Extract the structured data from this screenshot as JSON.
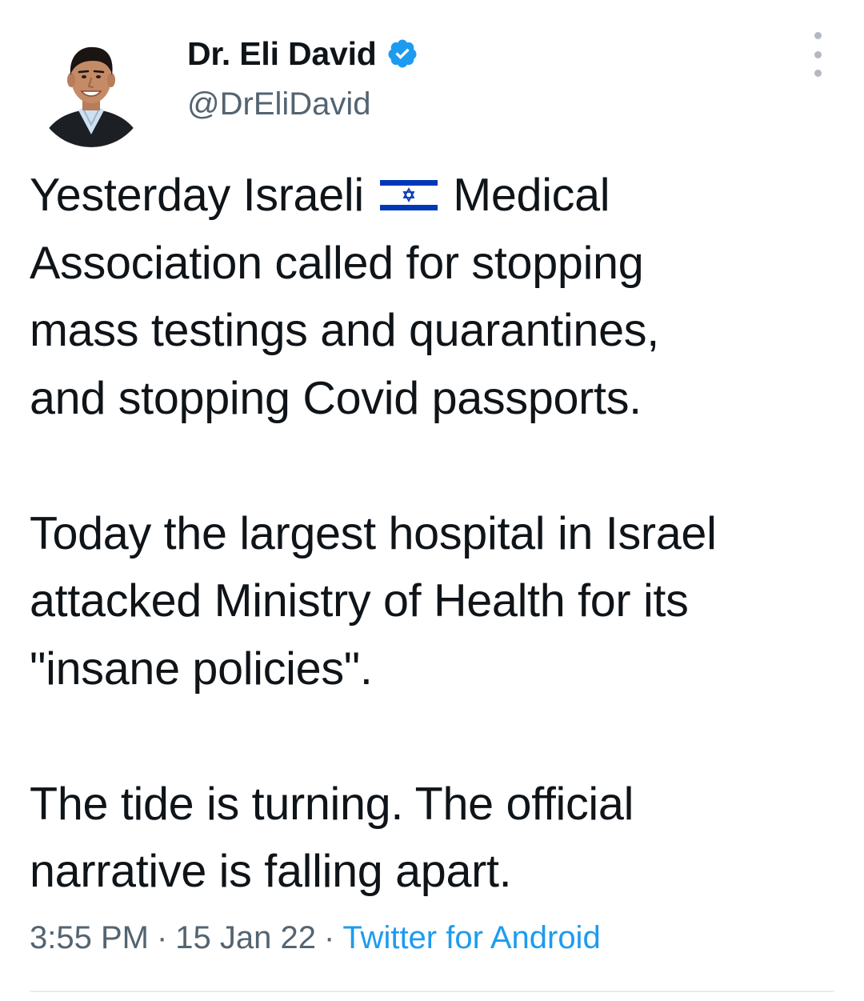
{
  "author": {
    "display_name": "Dr. Eli David",
    "handle": "@DrEliDavid",
    "verified_icon": "verified-badge-icon",
    "avatar": "profile-photo"
  },
  "menu": {
    "icon": "more-vertical-icon"
  },
  "tweet": {
    "paragraph_1": {
      "line_1_before_flag": "Yesterday Israeli",
      "flag_icon": "israel-flag-icon",
      "line_1_after_flag": "Medical",
      "line_2": "Association called for stopping",
      "line_3": "mass testings and quarantines,",
      "line_4": "and stopping Covid passports."
    },
    "paragraph_2": {
      "line_1": "Today the largest hospital in Israel",
      "line_2": "attacked Ministry of Health for its",
      "line_3": "\"insane policies\"."
    },
    "paragraph_3": {
      "line_1": "The tide is turning. The official",
      "line_2": "narrative is falling apart."
    }
  },
  "meta": {
    "time": "3:55 PM",
    "separator": "·",
    "date": "15 Jan 22",
    "source": "Twitter for Android"
  },
  "colors": {
    "text_primary": "#0f1419",
    "text_secondary": "#536471",
    "link": "#1d9bf0",
    "verified": "#1d9bf0",
    "flag_blue": "#0038b8"
  }
}
